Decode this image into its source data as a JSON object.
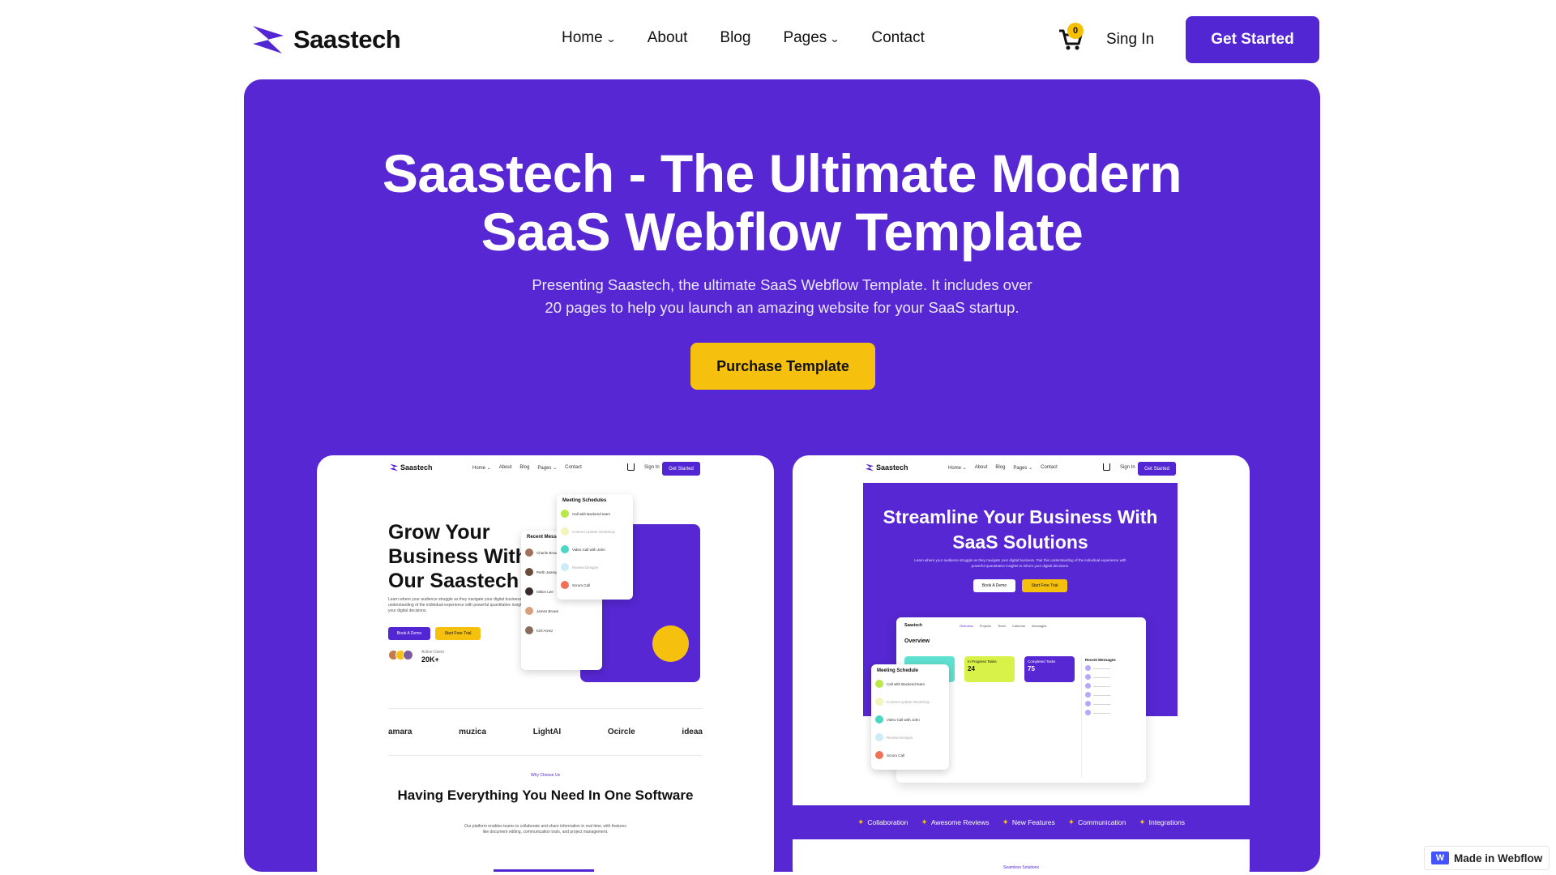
{
  "nav": {
    "logo_text": "Saastech",
    "menu": [
      {
        "label": "Home",
        "has_dropdown": true
      },
      {
        "label": "About",
        "has_dropdown": false
      },
      {
        "label": "Blog",
        "has_dropdown": false
      },
      {
        "label": "Pages",
        "has_dropdown": true
      },
      {
        "label": "Contact",
        "has_dropdown": false
      }
    ],
    "cart_count": "0",
    "signin_label": "Sing In",
    "cta_label": "Get Started"
  },
  "hero": {
    "title_line1": "Saastech - The Ultimate Modern",
    "title_line2": "SaaS Webflow Template",
    "subtitle_line1": "Presenting Saastech, the ultimate SaaS Webflow Template. It includes over",
    "subtitle_line2": "20 pages to help you launch an amazing website for your SaaS startup.",
    "purchase_label": "Purchase Template"
  },
  "preview_a": {
    "nav": {
      "logo": "Saastech",
      "menu": [
        "Home ⌄",
        "About",
        "Blog",
        "Pages ⌄",
        "Contact"
      ],
      "signin": "Sign In",
      "cta": "Get Started"
    },
    "title": "Grow Your Business With Our Saastech",
    "text": "Learn where your audience struggle as they navigate your digital business. Pair this understanding of the individual experience with powerful quantitative insights to inform your digital decisions.",
    "btn_demo": "Book A Demo",
    "btn_trial": "Start Free Trial",
    "users_label": "Active Users",
    "users_value": "20K+",
    "schedule_title": "Meeting Schedules",
    "schedule_items": [
      "Call with Backend team",
      "Content Update Workshop",
      "Video Call with John",
      "Review Designs",
      "Scrum Call"
    ],
    "messages_title": "Recent Messages",
    "message_items": [
      "Charlie Brown",
      "Perth Jamey",
      "Milton Lee",
      "James Brown",
      "Kiril Arnez"
    ],
    "brands": [
      "amara",
      "muzica",
      "LightAI",
      "Ocircle",
      "ideaa"
    ],
    "why_label": "Why Choose Us",
    "section_title": "Having Everything You Need In One Software",
    "section_text": "Our platform enables teams to collaborate and share information in real time, with features like document editing, communication tools, and project management."
  },
  "preview_b": {
    "nav": {
      "logo": "Saastech",
      "menu": [
        "Home ⌄",
        "About",
        "Blog",
        "Pages ⌄",
        "Contact"
      ],
      "signin": "Sign In",
      "cta": "Get Started"
    },
    "title": "Streamline Your Business With SaaS Solutions",
    "text": "Learn where your audience struggle as they navigate your digital business. Pair this understanding of the individual experience with powerful quantitative insights to inform your digital decisions.",
    "btn_demo": "Book A Demo",
    "btn_trial": "Start Free Trial",
    "dash_logo": "Saastech",
    "dash_tabs": [
      "Overview",
      "Projects",
      "Team",
      "Calendar",
      "Messages"
    ],
    "overview_label": "Overview",
    "stats": [
      {
        "label": "In Progress Tasks",
        "value": "24"
      },
      {
        "label": "Completed Tasks",
        "value": "75"
      }
    ],
    "recent_messages": "Recent Messages",
    "schedule_title": "Meeting Schedule",
    "features": [
      "Collaboration",
      "Awesome Reviews",
      "New Features",
      "Communication",
      "Integrations"
    ],
    "seam_label": "Seamless Solutions"
  },
  "badge": {
    "label": "Made in Webflow"
  },
  "colors": {
    "brand": "#5627d2",
    "accent": "#f6c10e",
    "text": "#111111"
  }
}
